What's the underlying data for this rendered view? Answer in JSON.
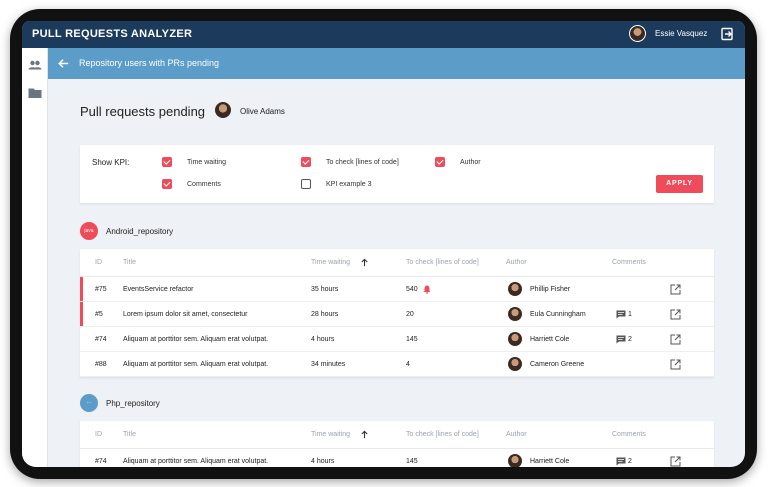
{
  "app": {
    "title": "PULL REQUESTS ANALYZER",
    "user_name": "Essie Vasquez"
  },
  "subheader": {
    "title": "Repository users with PRs pending"
  },
  "page": {
    "title": "Pull requests pending",
    "owner": "Olive Adams"
  },
  "kpi": {
    "label": "Show KPI:",
    "options": [
      {
        "label": "Time waiting",
        "checked": true
      },
      {
        "label": "To check [lines of code]",
        "checked": true
      },
      {
        "label": "Author",
        "checked": true
      },
      {
        "label": "Comments",
        "checked": true
      },
      {
        "label": "KPI example 3",
        "checked": false
      }
    ],
    "apply_label": "APPLY"
  },
  "colors": {
    "accent": "#ef4b5a",
    "header": "#1b3a5c",
    "subheader": "#5b9cc9",
    "php_badge": "#5b9cc9"
  },
  "columns": {
    "id": "ID",
    "title": "Title",
    "time_waiting": "Time waiting",
    "to_check": "To check [lines of code]",
    "author": "Author",
    "comments": "Comments"
  },
  "repos": [
    {
      "badge": "java",
      "name": "Android_repository",
      "rows": [
        {
          "id": "#75",
          "title": "EventsService refactor",
          "time": "35 hours",
          "lines": "540",
          "alert": true,
          "author": "Phillip Fisher",
          "comments": "",
          "flagged": true
        },
        {
          "id": "#5",
          "title": "Lorem ipsum dolor sit amet, consectetur",
          "time": "28 hours",
          "lines": "20",
          "alert": false,
          "author": "Eula Cunningham",
          "comments": "1",
          "flagged": true
        },
        {
          "id": "#74",
          "title": "Aliquam at porttitor sem.  Aliquam erat volutpat.",
          "time": "4 hours",
          "lines": "145",
          "alert": false,
          "author": "Harriett Cole",
          "comments": "2",
          "flagged": false
        },
        {
          "id": "#88",
          "title": "Aliquam at porttitor sem.  Aliquam erat volutpat.",
          "time": "34 minutes",
          "lines": "4",
          "alert": false,
          "author": "Cameron Greene",
          "comments": "",
          "flagged": false
        }
      ]
    },
    {
      "badge": "···",
      "name": "Php_repository",
      "rows": [
        {
          "id": "#74",
          "title": "Aliquam at porttitor sem.  Aliquam erat volutpat.",
          "time": "4 hours",
          "lines": "145",
          "alert": false,
          "author": "Harriett Cole",
          "comments": "2",
          "flagged": false
        }
      ]
    }
  ]
}
